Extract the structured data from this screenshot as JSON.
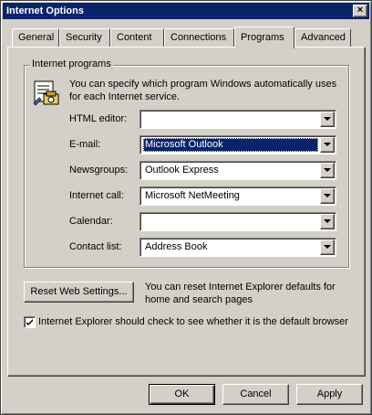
{
  "window": {
    "title": "Internet Options",
    "close_glyph": "×"
  },
  "tabs": [
    {
      "label": "General"
    },
    {
      "label": "Security"
    },
    {
      "label": "Content"
    },
    {
      "label": "Connections"
    },
    {
      "label": "Programs",
      "active": true
    },
    {
      "label": "Advanced"
    }
  ],
  "programs": {
    "group_title": "Internet programs",
    "description": "You can specify which program Windows automatically uses for each Internet service.",
    "icon": "programs-icon",
    "rows": [
      {
        "label": "HTML editor:",
        "value": ""
      },
      {
        "label": "E-mail:",
        "value": "Microsoft Outlook",
        "selected": true
      },
      {
        "label": "Newsgroups:",
        "value": "Outlook Express"
      },
      {
        "label": "Internet call:",
        "value": "Microsoft NetMeeting"
      },
      {
        "label": "Calendar:",
        "value": ""
      },
      {
        "label": "Contact list:",
        "value": "Address Book"
      }
    ]
  },
  "reset": {
    "button_label": "Reset Web Settings...",
    "description": "You can reset Internet Explorer defaults for home and search pages"
  },
  "default_check": {
    "checked": true,
    "label": "Internet Explorer should check to see whether it is the default browser"
  },
  "footer": {
    "ok_label": "OK",
    "cancel_label": "Cancel",
    "apply_label": "Apply"
  },
  "colors": {
    "titlebar": "#0a246a",
    "face": "#d4d0c8",
    "selection": "#0a246a"
  }
}
